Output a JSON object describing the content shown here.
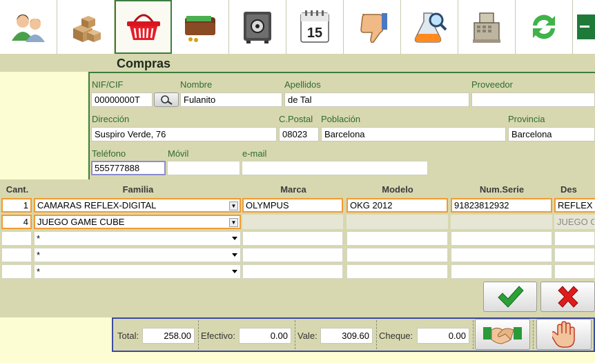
{
  "toolbar": {
    "buttons": [
      {
        "name": "clients-icon"
      },
      {
        "name": "boxes-icon"
      },
      {
        "name": "basket-icon",
        "active": true
      },
      {
        "name": "wallet-icon"
      },
      {
        "name": "safe-icon"
      },
      {
        "name": "calendar-icon",
        "label": "15"
      },
      {
        "name": "thumbs-down-icon"
      },
      {
        "name": "flask-search-icon"
      },
      {
        "name": "cash-register-icon"
      },
      {
        "name": "refresh-icon"
      },
      {
        "name": "excel-icon"
      }
    ]
  },
  "page": {
    "title": "Compras"
  },
  "client": {
    "nif_label": "NIF/CIF",
    "nif": "00000000T",
    "nombre_label": "Nombre",
    "nombre": "Fulanito",
    "apellidos_label": "Apellidos",
    "apellidos": "de Tal",
    "proveedor_label": "Proveedor",
    "proveedor": "",
    "direccion_label": "Dirección",
    "direccion": "Suspiro Verde, 76",
    "cpostal_label": "C.Postal",
    "cpostal": "08023",
    "poblacion_label": "Población",
    "poblacion": "Barcelona",
    "provincia_label": "Provincia",
    "provincia": "Barcelona",
    "telefono_label": "Teléfono",
    "telefono": "555777888",
    "movil_label": "Móvil",
    "movil": "",
    "email_label": "e-mail",
    "email": ""
  },
  "grid": {
    "headers": {
      "cant": "Cant.",
      "familia": "Familia",
      "marca": "Marca",
      "modelo": "Modelo",
      "numserie": "Num.Serie",
      "desc": "Des"
    },
    "rows": [
      {
        "cant": "1",
        "familia": "CAMARAS REFLEX-DIGITAL",
        "marca": "OLYMPUS",
        "modelo": "OKG 2012",
        "numserie": "91823812932",
        "desc": "REFLEX D"
      },
      {
        "cant": "4",
        "familia": "JUEGO GAME CUBE",
        "marca": "",
        "modelo": "",
        "numserie": "",
        "desc": "JUEGO G"
      },
      {
        "cant": "",
        "familia": "*",
        "marca": "",
        "modelo": "",
        "numserie": "",
        "desc": ""
      },
      {
        "cant": "",
        "familia": "*",
        "marca": "",
        "modelo": "",
        "numserie": "",
        "desc": ""
      },
      {
        "cant": "",
        "familia": "*",
        "marca": "",
        "modelo": "",
        "numserie": "",
        "desc": ""
      }
    ]
  },
  "actions": {
    "accept": "check-icon",
    "cancel": "cross-icon"
  },
  "totals": {
    "total_label": "Total:",
    "total": "258.00",
    "efectivo_label": "Efectivo:",
    "efectivo": "0.00",
    "vale_label": "Vale:",
    "vale": "309.60",
    "cheque_label": "Cheque:",
    "cheque": "0.00"
  },
  "colors": {
    "panel": "#d7d8b0",
    "background": "#fdfdd3",
    "accent_green": "#3c7d3c",
    "highlight_orange": "#f19b32",
    "totals_border": "#3c4aa0"
  }
}
